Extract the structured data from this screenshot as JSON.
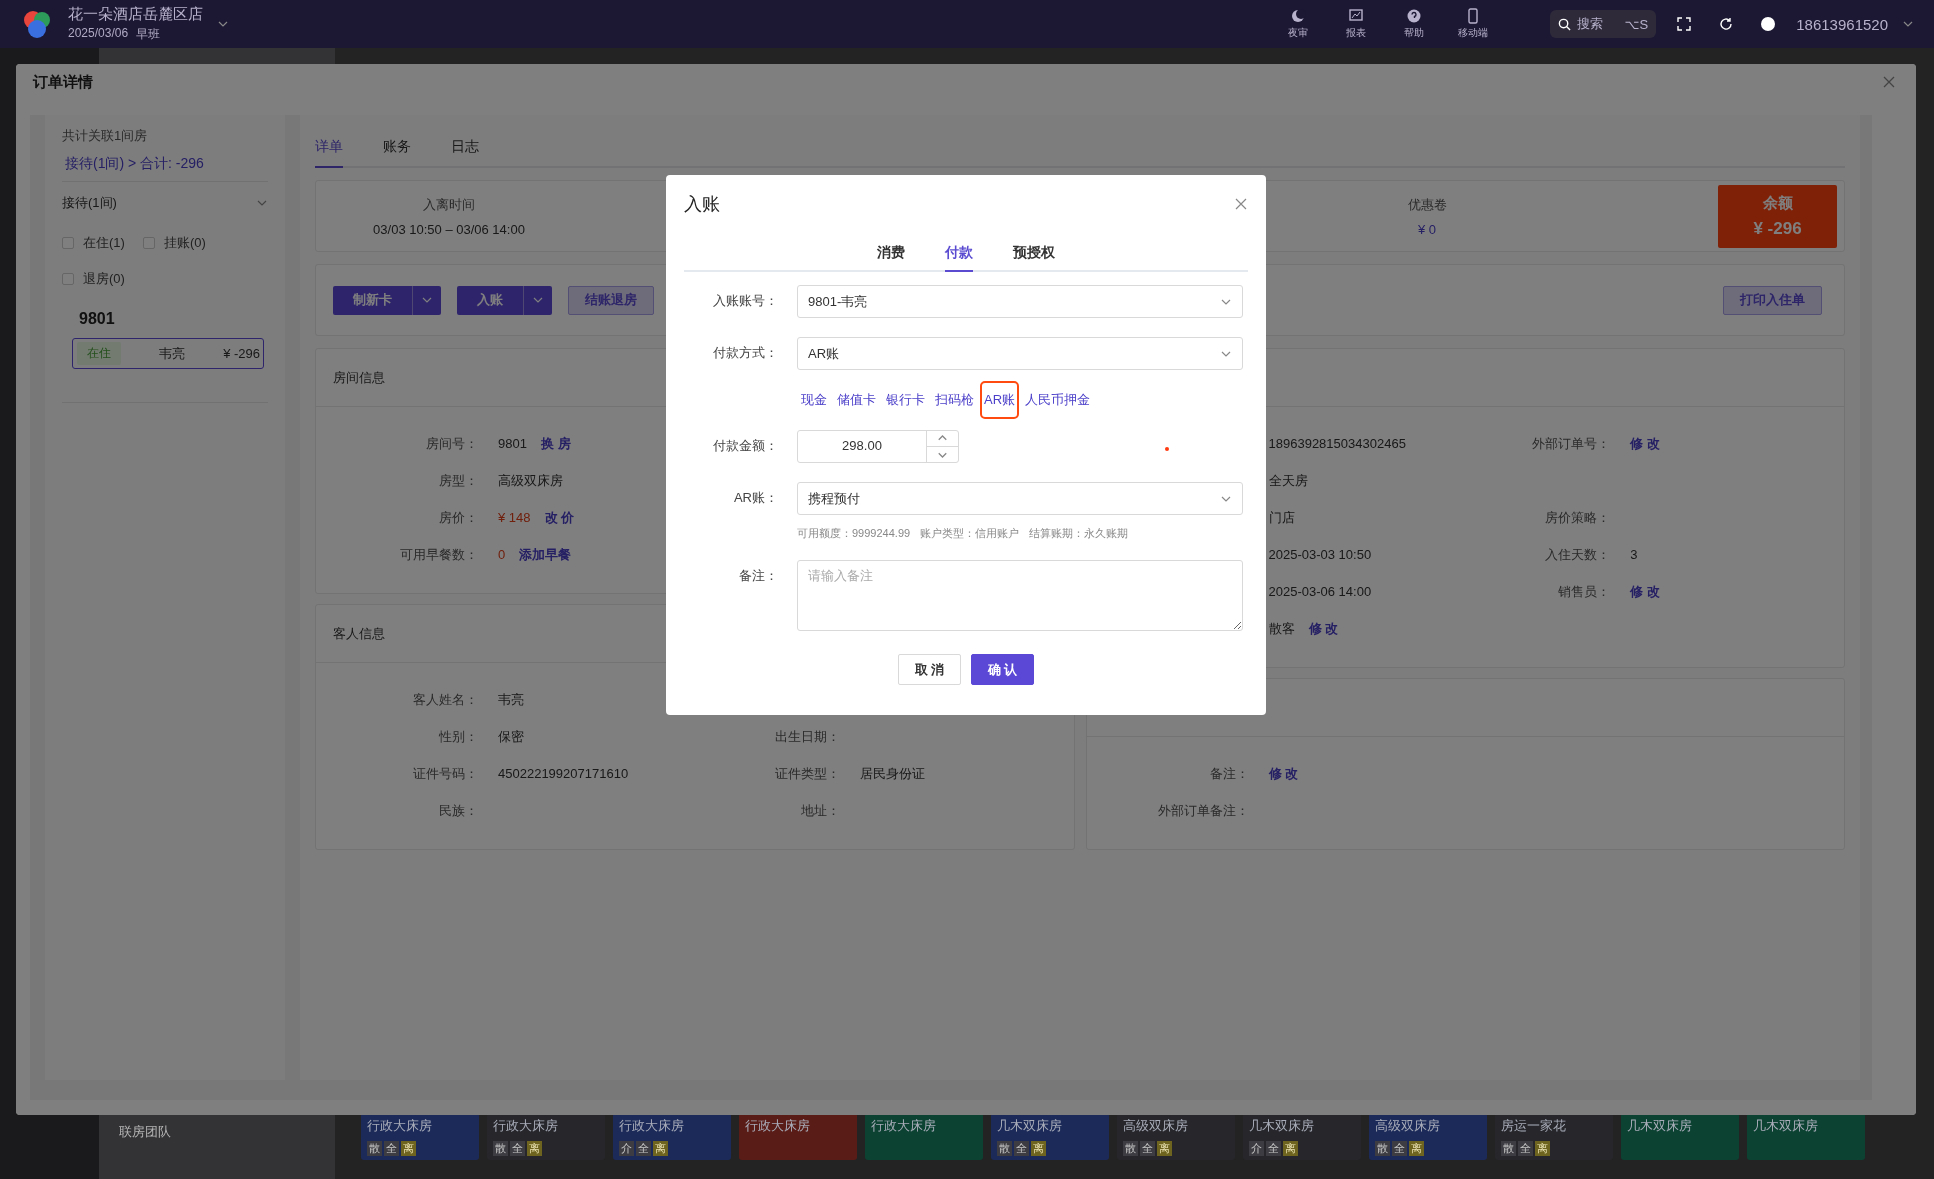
{
  "topbar": {
    "store": "花一朵酒店岳麓区店",
    "date": "2025/03/06",
    "shift": "早班",
    "tools": [
      {
        "kind": "moon",
        "label": "夜审"
      },
      {
        "kind": "chart",
        "label": "报表"
      },
      {
        "kind": "help",
        "label": "帮助"
      },
      {
        "kind": "phone",
        "label": "移动端"
      }
    ],
    "search": {
      "placeholder": "搜索",
      "shortcut": "⌥S"
    },
    "user": "18613961520"
  },
  "bottom": {
    "sidebar_item": "联房团队",
    "rooms": [
      {
        "type": "行政大床房",
        "color": "#1c2a5a",
        "tags": [
          "散",
          "全",
          "离"
        ]
      },
      {
        "type": "行政大床房",
        "color": "#26262b",
        "tags": [
          "散",
          "全",
          "离"
        ]
      },
      {
        "type": "行政大床房",
        "color": "#1c2a5a",
        "tags": [
          "介",
          "全",
          "离"
        ]
      },
      {
        "type": "行政大床房",
        "color": "#5a1c17"
      },
      {
        "type": "行政大床房",
        "color": "#0b4232"
      },
      {
        "type": "几木双床房",
        "color": "#1c2a5a",
        "tags": [
          "散",
          "全",
          "离"
        ]
      },
      {
        "type": "高级双床房",
        "color": "#26262b",
        "tags": [
          "散",
          "全",
          "离"
        ]
      },
      {
        "type": "几木双床房",
        "color": "#26262b",
        "tags": [
          "介",
          "全",
          "离"
        ]
      },
      {
        "type": "高级双床房",
        "color": "#1c2a5a",
        "tags": [
          "散",
          "全",
          "离"
        ]
      },
      {
        "type": "房运一家花",
        "color": "#26262b",
        "tags": [
          "散",
          "全",
          "离"
        ]
      },
      {
        "type": "几木双床房",
        "color": "#0b4232"
      },
      {
        "type": "几木双床房",
        "color": "#0b4232"
      }
    ]
  },
  "drawer": {
    "title": "订单详情",
    "left_panel": {
      "summary": "共计关联1间房",
      "total_link": "接待(1间) > 合计: -296",
      "group": {
        "title": "接待(1间)",
        "expanded": true
      },
      "filters": [
        {
          "label": "在住(1)",
          "checked": false
        },
        {
          "label": "挂账(0)",
          "checked": false
        },
        {
          "label": "退房(0)",
          "checked": false
        }
      ],
      "room_no": "9801",
      "guests": [
        {
          "status": "在住",
          "name": "韦亮",
          "amount": "¥ -296",
          "selected": true
        }
      ]
    },
    "tabs": [
      {
        "label": "详单",
        "selected": true
      },
      {
        "label": "账务",
        "selected": false
      },
      {
        "label": "日志",
        "selected": false
      }
    ],
    "summary": [
      {
        "label": "入离时间",
        "value": "03/03 10:50 – 03/06 14:00"
      },
      {
        "label": "优惠卷",
        "value": "¥ 0"
      }
    ],
    "balance": {
      "label": "余额",
      "value": "¥ -296"
    },
    "actions": [
      {
        "label": "制新卡",
        "kind": "split"
      },
      {
        "label": "入账",
        "kind": "split"
      },
      {
        "label": "结账退房",
        "kind": "outline"
      }
    ],
    "print_button": "打印入住单",
    "room_card": {
      "title": "房间信息",
      "rows": [
        [
          {
            "label": "房间号：",
            "value": "9801",
            "link": "换 房"
          }
        ],
        [
          {
            "label": "房型：",
            "value": "高级双床房"
          }
        ],
        [
          {
            "label": "房价：",
            "value": "¥ 148",
            "accent": true,
            "link": "改 价"
          }
        ],
        [
          {
            "label": "可用早餐数：",
            "value": "0",
            "accent": true,
            "link": "添加早餐"
          }
        ]
      ]
    },
    "order_card": {
      "rows": [
        [
          {
            "value": "1896392815034302465"
          },
          {
            "label": "外部订单号：",
            "link": "修 改"
          }
        ],
        [
          {
            "value": "全天房"
          }
        ],
        [
          {
            "value": "门店"
          },
          {
            "label": "房价策略："
          }
        ],
        [
          {
            "value": "2025-03-03 10:50"
          },
          {
            "label": "入住天数：",
            "value": "3"
          }
        ],
        [
          {
            "value": "2025-03-06 14:00"
          },
          {
            "label": "销售员：",
            "link": "修 改"
          }
        ],
        [
          {
            "value": "散客",
            "link": "修 改"
          }
        ]
      ]
    },
    "guest_card": {
      "title": "客人信息",
      "rows": [
        [
          {
            "label": "客人姓名：",
            "value": "韦亮"
          }
        ],
        [
          {
            "label": "性别：",
            "value": "保密"
          },
          {
            "label": "出生日期："
          }
        ],
        [
          {
            "label": "证件号码：",
            "value": "450222199207171610"
          },
          {
            "label": "证件类型：",
            "value": "居民身份证"
          }
        ],
        [
          {
            "label": "民族："
          },
          {
            "label": "地址："
          }
        ]
      ]
    },
    "other_card": {
      "rows": [
        [
          {
            "label": "备注：",
            "link": "修 改"
          }
        ],
        [
          {
            "label": "外部订单备注："
          }
        ]
      ]
    }
  },
  "dialog": {
    "title": "入账",
    "tabs": [
      {
        "label": "消费",
        "selected": false
      },
      {
        "label": "付款",
        "selected": true
      },
      {
        "label": "预授权",
        "selected": false
      }
    ],
    "fields": [
      {
        "kind": "select",
        "label": "入账账号：",
        "value": "9801-韦亮"
      },
      {
        "kind": "select",
        "label": "付款方式：",
        "value": "AR账"
      },
      {
        "kind": "quick",
        "options": [
          {
            "label": "现金",
            "selected": false
          },
          {
            "label": "储值卡",
            "selected": false
          },
          {
            "label": "银行卡",
            "selected": false
          },
          {
            "label": "扫码枪",
            "selected": false
          },
          {
            "label": "AR账",
            "selected": true
          },
          {
            "label": "人民币押金",
            "selected": false
          }
        ]
      },
      {
        "kind": "number",
        "label": "付款金额：",
        "value": "298.00"
      },
      {
        "kind": "select",
        "label": "AR账：",
        "value": "携程预付",
        "hint": [
          "可用额度：9999244.99",
          "账户类型：信用账户",
          "结算账期：永久账期"
        ]
      },
      {
        "kind": "textarea",
        "label": "备注：",
        "placeholder": "请输入备注"
      }
    ],
    "buttons": [
      {
        "label": "取 消",
        "kind": "default"
      },
      {
        "label": "确 认",
        "kind": "primary"
      }
    ]
  }
}
